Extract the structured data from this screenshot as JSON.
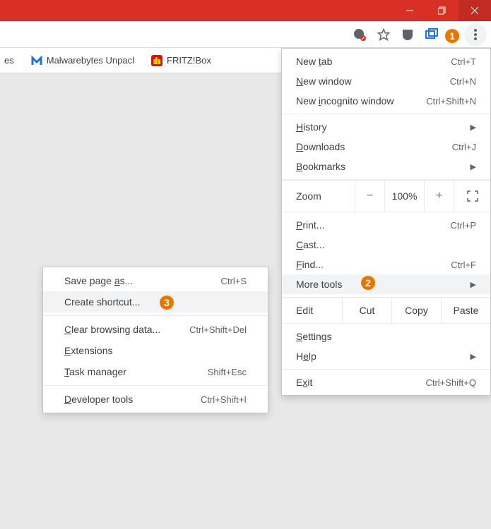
{
  "window_buttons": {
    "min": "−",
    "max": "❐",
    "close": "✕"
  },
  "toolbar_icons": [
    "cookie-blocker-icon",
    "star-icon",
    "ublock-icon",
    "tab-manager-icon"
  ],
  "bookmarks": [
    {
      "label": "es",
      "icon": ""
    },
    {
      "label": "Malwarebytes Unpacl",
      "icon": "mb"
    },
    {
      "label": "FRITZ!Box",
      "icon": "fb"
    }
  ],
  "annotations": {
    "b1": "1",
    "b2": "2",
    "b3": "3"
  },
  "main_menu": {
    "section1": [
      {
        "label": "New tab",
        "u": "t",
        "sc": "Ctrl+T",
        "arrow": false
      },
      {
        "label": "New window",
        "u": "N",
        "sc": "Ctrl+N",
        "arrow": false
      },
      {
        "label": "New incognito window",
        "u": "i",
        "sc": "Ctrl+Shift+N",
        "arrow": false
      }
    ],
    "section2": [
      {
        "label": "History",
        "u": "H",
        "sc": "",
        "arrow": true
      },
      {
        "label": "Downloads",
        "u": "D",
        "sc": "Ctrl+J",
        "arrow": false
      },
      {
        "label": "Bookmarks",
        "u": "B",
        "sc": "",
        "arrow": true
      }
    ],
    "zoom": {
      "label": "Zoom",
      "minus": "−",
      "value": "100%",
      "plus": "+"
    },
    "section3": [
      {
        "label": "Print...",
        "u": "P",
        "sc": "Ctrl+P",
        "arrow": false
      },
      {
        "label": "Cast...",
        "u": "C",
        "sc": "",
        "arrow": false
      },
      {
        "label": "Find...",
        "u": "F",
        "sc": "Ctrl+F",
        "arrow": false
      },
      {
        "label": "More tools",
        "u": "",
        "sc": "",
        "arrow": true,
        "highlight": true
      }
    ],
    "edit": {
      "label": "Edit",
      "cut": "Cut",
      "copy": "Copy",
      "paste": "Paste"
    },
    "section4": [
      {
        "label": "Settings",
        "u": "S",
        "sc": "",
        "arrow": false
      },
      {
        "label": "Help",
        "u": "e",
        "sc": "",
        "arrow": true
      }
    ],
    "section5": [
      {
        "label": "Exit",
        "u": "x",
        "sc": "Ctrl+Shift+Q",
        "arrow": false
      }
    ]
  },
  "submenu": {
    "section1": [
      {
        "label": "Save page as...",
        "u": "a",
        "sc": "Ctrl+S"
      },
      {
        "label": "Create shortcut...",
        "u": "",
        "sc": "",
        "highlight": true
      }
    ],
    "section2": [
      {
        "label": "Clear browsing data...",
        "u": "C",
        "sc": "Ctrl+Shift+Del"
      },
      {
        "label": "Extensions",
        "u": "E",
        "sc": ""
      },
      {
        "label": "Task manager",
        "u": "T",
        "sc": "Shift+Esc"
      }
    ],
    "section3": [
      {
        "label": "Developer tools",
        "u": "D",
        "sc": "Ctrl+Shift+I"
      }
    ]
  }
}
